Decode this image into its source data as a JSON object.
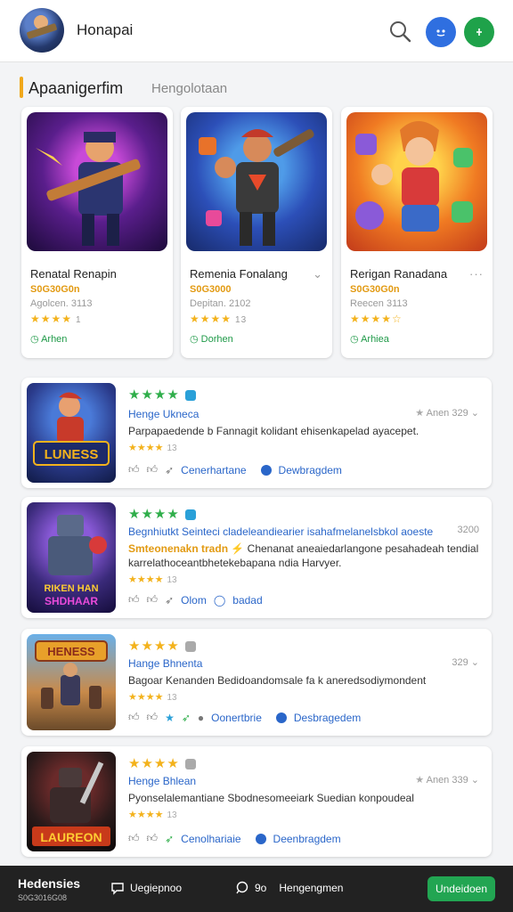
{
  "header": {
    "app_name": "Honapai"
  },
  "featured": {
    "title": "Apaanigerfim",
    "subtitle": "Hengolotaan",
    "cards": [
      {
        "title": "Renatal Renapin",
        "code": "S0G30G0n",
        "meta": "Agolcen. 3113",
        "stars": "★★★★",
        "reviews": "1",
        "action": "Arhen"
      },
      {
        "title": "Remenia Fonalang",
        "code": "S0G3000",
        "meta": "Depitan. 2102",
        "stars": "★★★★",
        "reviews": "13",
        "action": "Dorhen",
        "more": "⌄"
      },
      {
        "title": "Rerigan Ranadana",
        "code": "S0G30G0n",
        "meta": "Reecen 3113",
        "stars": "★★★★☆",
        "reviews": "",
        "action": "Arhiea",
        "more": "···"
      }
    ]
  },
  "list": [
    {
      "title": "Henge Ukneca",
      "count": "Anen 329",
      "desc": "Parpapaedende b Fannagit kolidant ehisenkapelad ayacepet.",
      "reviews": "13",
      "link1": "Cenerhartane",
      "link2": "Dewbragdem",
      "thumb_text": "LUNESS"
    },
    {
      "title": "Begnhiutkt Seinteci cladeleandiearier isahafmelanelsbkol aoeste",
      "title2": "Smteonenakn tradn",
      "count": "3200",
      "desc": "Chenanat aneaiedarlangone pesahadeah tendial karrelathoceantbhetekebapana ndia Harvyer.",
      "reviews": "13",
      "link1": "Olom",
      "link2": "badad",
      "thumb_text": "RIKEN HAN SHDHAAR"
    },
    {
      "title": "Hange Bhnenta",
      "count": "329",
      "desc": "Bagoar Kenanden Bedidoandomsale fa k aneredsodiymondent",
      "reviews": "13",
      "link1": "Oonertbrie",
      "link2": "Desbragedem",
      "thumb_text": "HENESS"
    },
    {
      "title": "Henge Bhlean",
      "count": "Anen 339",
      "desc": "Pyonselalemantiane Sbodnesomeeiark Suedian konpoudeal",
      "reviews": "13",
      "link1": "Cenolhariaie",
      "link2": "Deenbragdem",
      "thumb_text": "LAUREON"
    }
  ],
  "bottom": {
    "title": "Hedensies",
    "sub": "S0G3016G08",
    "item1": "Uegiepnoo",
    "item2_prefix": "9o",
    "item2": "Hengengmen",
    "button": "Undeidoen"
  },
  "colors": {
    "accent_orange": "#f0a81c",
    "link_blue": "#2a66c9",
    "green": "#1fa24a",
    "star": "#f3b21c"
  }
}
